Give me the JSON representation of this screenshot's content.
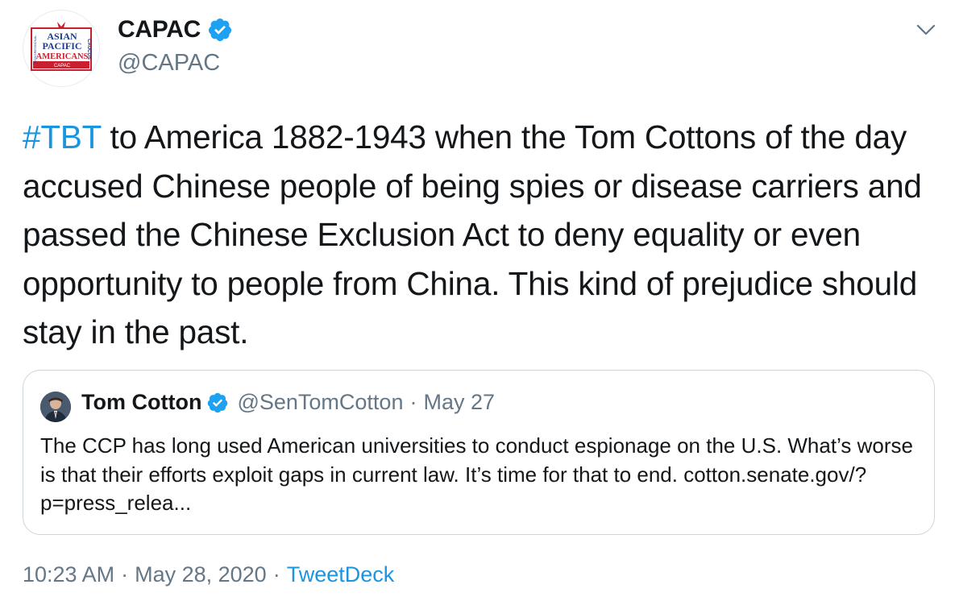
{
  "author": {
    "name": "CAPAC",
    "handle": "@CAPAC",
    "verified": true,
    "logo_lines": [
      "ASIAN",
      "PACIFIC",
      "AMERICANS",
      "CAPAC",
      "CONGRESSIONAL",
      "CAUCUS"
    ]
  },
  "menu_icon": "chevron-down-icon",
  "tweet": {
    "hashtag": "#TBT",
    "text": " to America 1882-1943 when the Tom Cottons of the day accused Chinese people of being spies or disease carriers and passed the Chinese Exclusion Act to deny equality or even opportunity to people from China. This kind of prejudice should stay in the past."
  },
  "quote": {
    "name": "Tom Cotton",
    "handle": "@SenTomCotton",
    "dot": "·",
    "date": "May 27",
    "text": "The CCP has long used American universities to conduct espionage on the U.S. What’s worse is that their efforts exploit gaps in current law. It’s time for that to end. cotton.senate.gov/?p=press_relea..."
  },
  "footer": {
    "time": "10:23 AM",
    "sep1": "·",
    "date": "May 28, 2020",
    "sep2": "·",
    "source": "TweetDeck"
  },
  "colors": {
    "link": "#1b95e0",
    "secondary_text": "#657786",
    "border": "#ccd6dd",
    "verified": "#1da1f2",
    "logo_red": "#c8202f",
    "logo_blue": "#1f3c88"
  }
}
